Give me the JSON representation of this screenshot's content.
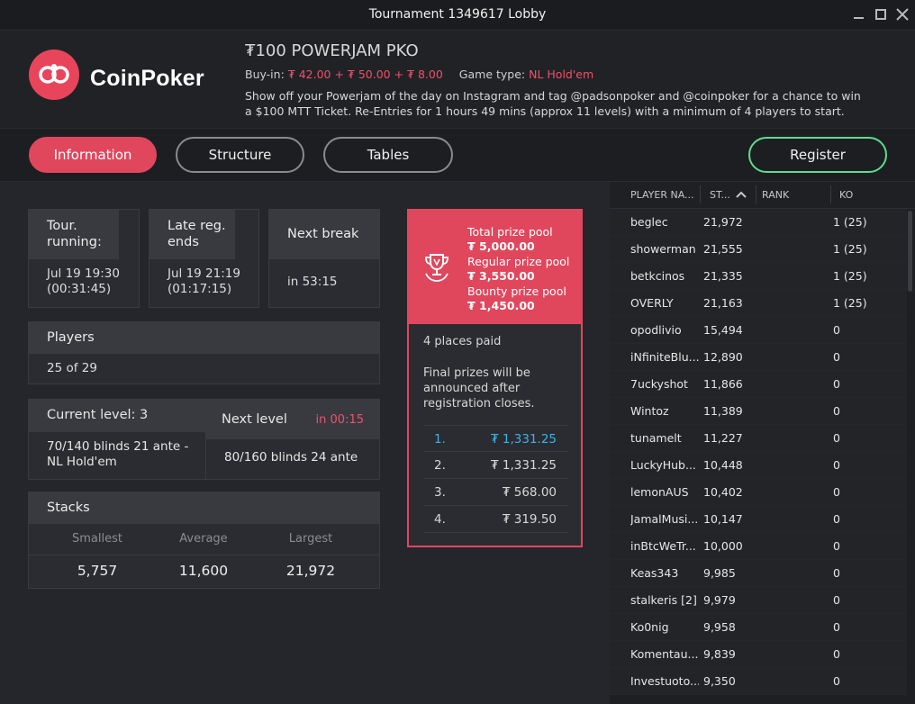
{
  "window": {
    "title": "Tournament 1349617 Lobby"
  },
  "brand": {
    "name": "CoinPoker"
  },
  "tournament": {
    "name": "₮100 POWERJAM PKO",
    "buyin_label": "Buy-in:",
    "buyin_value": "₮ 42.00 + ₮ 50.00 + ₮ 8.00",
    "gametype_label": "Game type:",
    "gametype_value": "NL Hold'em",
    "description": "Show off your Powerjam of the day on Instagram and tag @padsonpoker and @coinpoker for a chance to win a $100 MTT Ticket. Re-Entries for 1 hours 49 mins (approx 11 levels) with a minimum of 4 players to start."
  },
  "tabs": {
    "information": "Information",
    "structure": "Structure",
    "tables": "Tables",
    "register": "Register"
  },
  "info": {
    "running_label": "Tour. running:",
    "running_date": "Jul 19 19:30",
    "running_elapsed": "(00:31:45)",
    "latereg_label": "Late reg. ends",
    "latereg_date": "Jul 19 21:19",
    "latereg_remaining": "(01:17:15)",
    "break_label": "Next break",
    "break_value": "in 53:15",
    "players_label": "Players",
    "players_value": "25 of 29",
    "current_level_label": "Current level: 3",
    "current_level_value": "70/140 blinds 21 ante - NL Hold'em",
    "next_level_label": "Next level",
    "next_level_countdown": "in 00:15",
    "next_level_value": "80/160 blinds 24 ante",
    "stacks_label": "Stacks",
    "smallest_label": "Smallest",
    "average_label": "Average",
    "largest_label": "Largest",
    "smallest_value": "5,757",
    "average_value": "11,600",
    "largest_value": "21,972"
  },
  "prize": {
    "total_label": "Total prize pool",
    "total_value": "₮ 5,000.00",
    "regular_label": "Regular prize pool",
    "regular_value": "₮ 3,550.00",
    "bounty_label": "Bounty prize pool",
    "bounty_value": "₮ 1,450.00",
    "places_paid": "4 places paid",
    "final_note": "Final prizes will be announced after registration closes.",
    "payouts": [
      {
        "pos": "1.",
        "amount": "₮ 1,331.25"
      },
      {
        "pos": "2.",
        "amount": "₮ 1,331.25"
      },
      {
        "pos": "3.",
        "amount": "₮ 568.00"
      },
      {
        "pos": "4.",
        "amount": "₮ 319.50"
      }
    ]
  },
  "players_table": {
    "headers": {
      "name": "PLAYER NA...",
      "stack": "ST...",
      "rank": "RANK",
      "ko": "KO"
    },
    "rows": [
      {
        "name": "beglec",
        "stack": "21,972",
        "ko": "1 (25)"
      },
      {
        "name": "showerman",
        "stack": "21,555",
        "ko": "1 (25)"
      },
      {
        "name": "betkcinos",
        "stack": "21,335",
        "ko": "1 (25)"
      },
      {
        "name": "OVERLY",
        "stack": "21,163",
        "ko": "1 (25)"
      },
      {
        "name": "opodlivio",
        "stack": "15,494",
        "ko": "0"
      },
      {
        "name": "iNfiniteBlu...",
        "stack": "12,890",
        "ko": "0"
      },
      {
        "name": "7uckyshot",
        "stack": "11,866",
        "ko": "0"
      },
      {
        "name": "Wintoz",
        "stack": "11,389",
        "ko": "0"
      },
      {
        "name": "tunamelt",
        "stack": "11,227",
        "ko": "0"
      },
      {
        "name": "LuckyHub...",
        "stack": "10,448",
        "ko": "0"
      },
      {
        "name": "lemonAUS",
        "stack": "10,402",
        "ko": "0"
      },
      {
        "name": "JamalMusi...",
        "stack": "10,147",
        "ko": "0"
      },
      {
        "name": "inBtcWeTr...",
        "stack": "10,000",
        "ko": "0"
      },
      {
        "name": "Keas343",
        "stack": "9,985",
        "ko": "0"
      },
      {
        "name": "stalkeris [2]",
        "stack": "9,979",
        "ko": "0"
      },
      {
        "name": "Ko0nig",
        "stack": "9,958",
        "ko": "0"
      },
      {
        "name": "Komentau...",
        "stack": "9,839",
        "ko": "0"
      },
      {
        "name": "Investuoto...",
        "stack": "9,350",
        "ko": "0"
      }
    ]
  },
  "colors": {
    "accent": "#e0475d",
    "register_border": "#5fdc8f",
    "first_place": "#3ab3e8"
  }
}
